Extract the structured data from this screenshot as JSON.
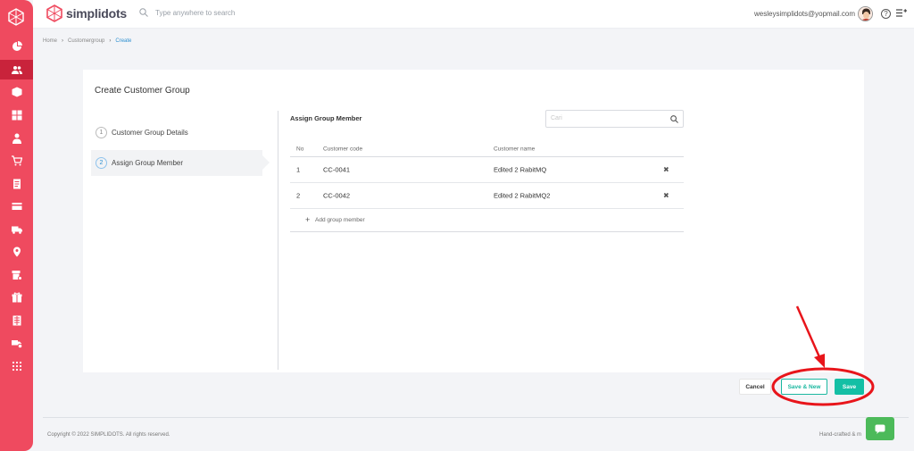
{
  "app": {
    "brand": "simplidots"
  },
  "topbar": {
    "search_placeholder": "Type anywhere to search",
    "user_email": "wesleysimplidots@yopmail.com"
  },
  "breadcrumb": [
    "Home",
    "Customergroup",
    "Create"
  ],
  "page": {
    "title": "Create Customer Group"
  },
  "steps": [
    {
      "num": "1",
      "label": "Customer Group Details"
    },
    {
      "num": "2",
      "label": "Assign Group Member"
    }
  ],
  "section": {
    "title": "Assign Group Member",
    "search_placeholder": "Cari"
  },
  "table": {
    "headers": [
      "No",
      "Customer code",
      "Customer name"
    ],
    "rows": [
      {
        "no": "1",
        "code": "CC-0041",
        "name": "Edited 2 RabitMQ"
      },
      {
        "no": "2",
        "code": "CC-0042",
        "name": "Edited 2 RabitMQ2"
      }
    ],
    "add_label": "Add group member"
  },
  "buttons": {
    "cancel": "Cancel",
    "save_new": "Save & New",
    "save": "Save"
  },
  "footer": {
    "copyright": "Copyright © 2022 SIMPLIDOTS. All rights reserved.",
    "handcrafted": "Hand-crafted & m"
  },
  "sidebar": {
    "icons": [
      "dashboard-icon",
      "customers-icon",
      "product-icon",
      "catalog-icon",
      "salesman-icon",
      "cart-icon",
      "invoice-icon",
      "payment-icon",
      "delivery-icon",
      "location-icon",
      "store-icon",
      "promo-icon",
      "report-icon",
      "truck-settings-icon",
      "apps-icon"
    ]
  },
  "colors": {
    "sidebar": "#ef4a5f",
    "accent": "#14bfa5",
    "link": "#2d8fd0",
    "annotation": "#e8151b"
  }
}
